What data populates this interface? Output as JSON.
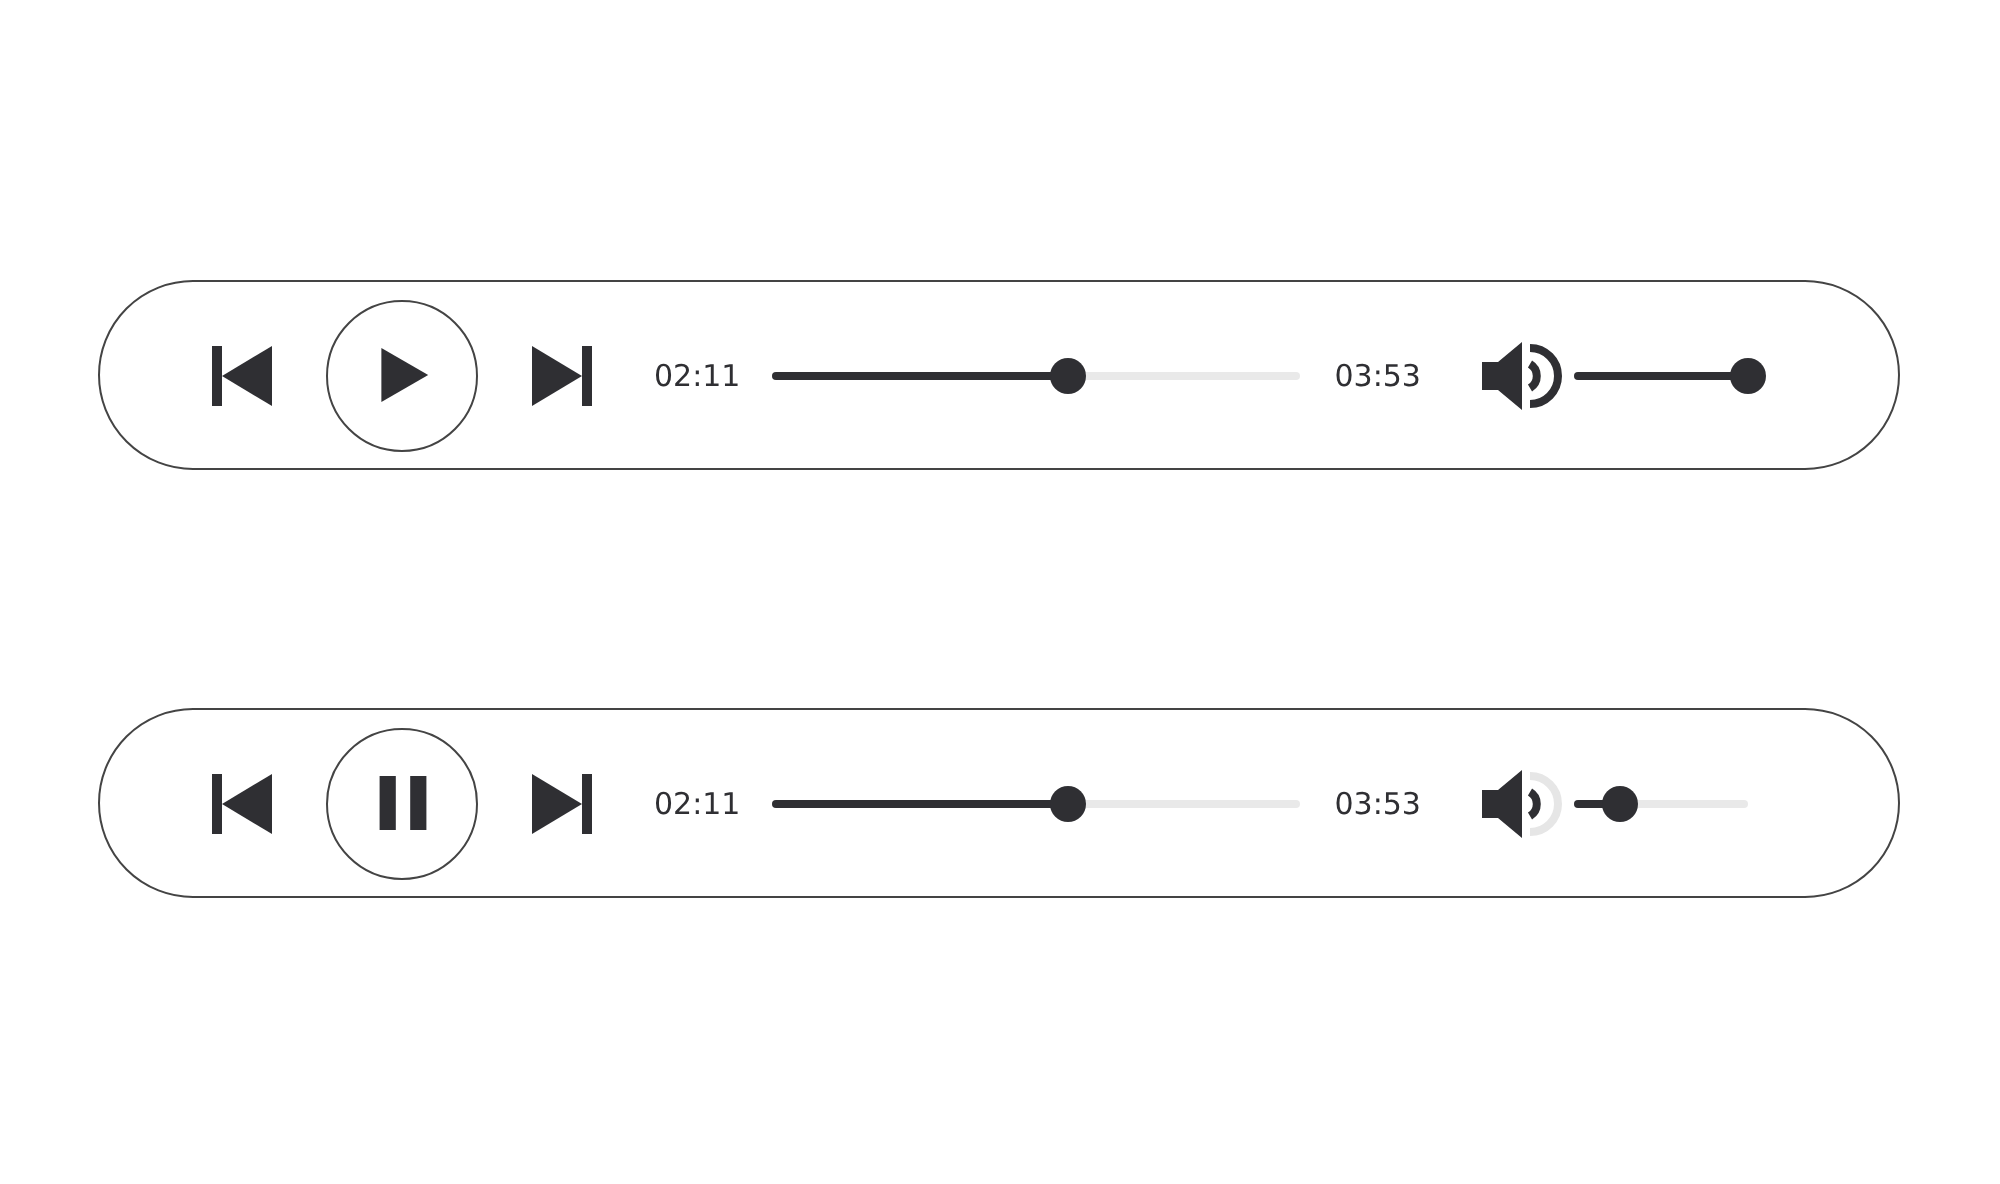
{
  "players": [
    {
      "playing": false,
      "elapsed": "02:11",
      "progress": {
        "level": 0.56
      },
      "duration": "03:53",
      "volume": {
        "level": 1.0
      }
    },
    {
      "playing": true,
      "elapsed": "02:11",
      "progress": {
        "level": 0.56
      },
      "duration": "03:53",
      "volume": {
        "level": 0.26
      }
    }
  ]
}
